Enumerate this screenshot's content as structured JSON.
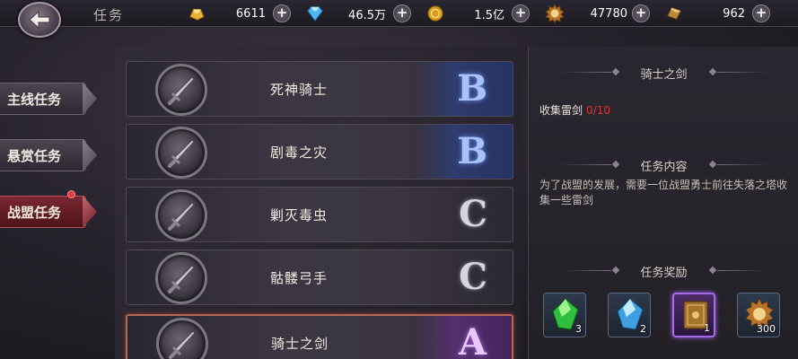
{
  "header": {
    "title": "任务",
    "resources": [
      {
        "name": "gold-ingot-icon",
        "value": "6611"
      },
      {
        "name": "blue-diamond-icon",
        "value": "46.5万"
      },
      {
        "name": "gold-coin-icon",
        "value": "1.5亿"
      },
      {
        "name": "honor-medal-icon",
        "value": "47780"
      },
      {
        "name": "bronze-ingot-icon",
        "value": "962"
      }
    ],
    "plus_label": "+"
  },
  "tabs": [
    {
      "label": "主线任务",
      "active": false
    },
    {
      "label": "悬赏任务",
      "active": false
    },
    {
      "label": "战盟任务",
      "active": true,
      "notification": true
    }
  ],
  "quests": [
    {
      "name": "死神骑士",
      "grade": "B"
    },
    {
      "name": "剧毒之灾",
      "grade": "B"
    },
    {
      "name": "剿灭毒虫",
      "grade": "C"
    },
    {
      "name": "骷髅弓手",
      "grade": "C"
    },
    {
      "name": "骑士之剑",
      "grade": "A",
      "selected": true
    }
  ],
  "detail": {
    "quest_title": "骑士之剑",
    "goal_label": "收集雷剑",
    "goal_progress": "0/10",
    "content_title": "任务内容",
    "content_text": "为了战盟的发展，需要一位战盟勇士前往失落之塔收集一些雷剑",
    "reward_title": "任务奖励",
    "rewards": [
      {
        "icon": "green-crystal-icon",
        "qty": "3"
      },
      {
        "icon": "blue-crystal-icon",
        "qty": "2"
      },
      {
        "icon": "skill-book-icon",
        "qty": "1"
      },
      {
        "icon": "honor-medal-icon",
        "qty": "300"
      }
    ]
  },
  "colors": {
    "progress_red": "#e03535",
    "active_tab": "#7a2730",
    "grade_b": "#a9c2ff",
    "grade_a": "#e8c9ff"
  }
}
